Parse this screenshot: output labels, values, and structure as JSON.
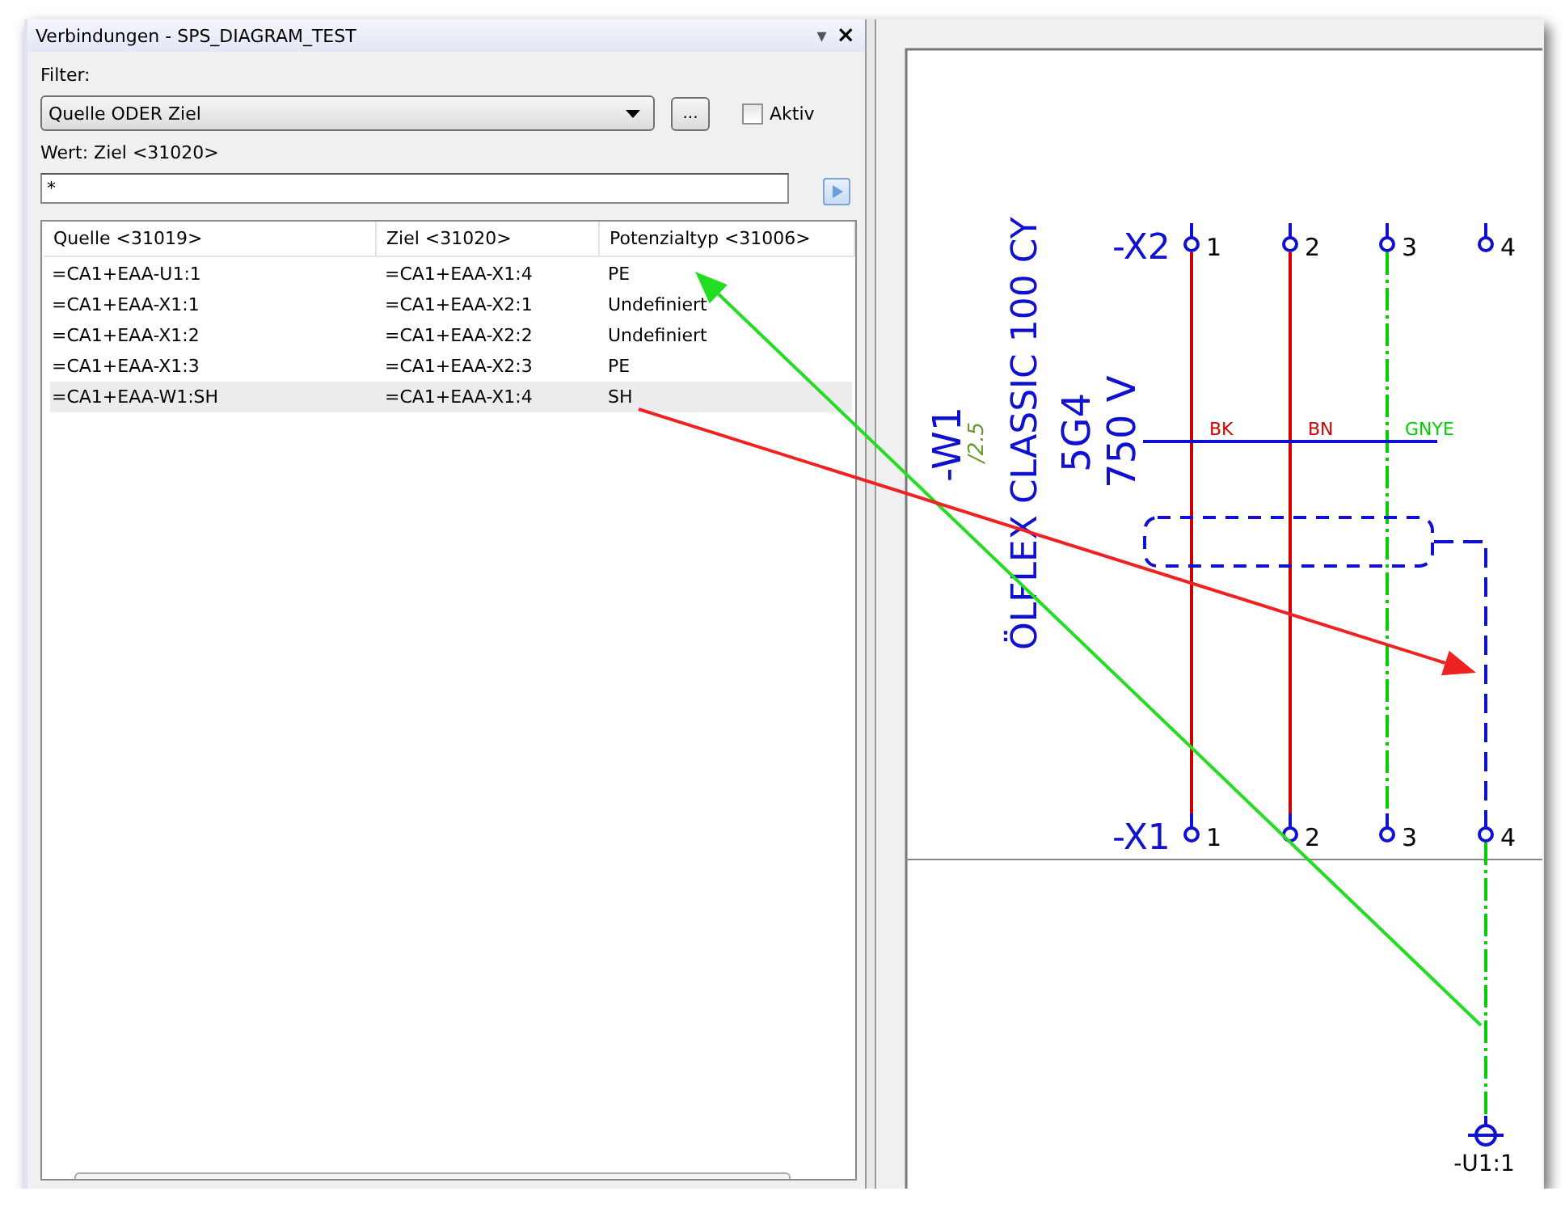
{
  "window": {
    "title": "Verbindungen - SPS_DIAGRAM_TEST",
    "menu_glyph": "▾",
    "close_glyph": "×"
  },
  "filter": {
    "label": "Filter:",
    "value": "Quelle ODER Ziel",
    "more_button": "...",
    "active": {
      "label": "Aktiv",
      "checked": false
    }
  },
  "value": {
    "label": "Wert: Ziel <31020>",
    "text": "*"
  },
  "table": {
    "columns": [
      "Quelle <31019>",
      "Ziel <31020>",
      "Potenzialtyp <31006>"
    ],
    "rows": [
      {
        "cells": [
          "=CA1+EAA-U1:1",
          "=CA1+EAA-X1:4",
          "PE"
        ],
        "selected": false
      },
      {
        "cells": [
          "=CA1+EAA-X1:1",
          "=CA1+EAA-X2:1",
          "Undefiniert"
        ],
        "selected": false
      },
      {
        "cells": [
          "=CA1+EAA-X1:2",
          "=CA1+EAA-X2:2",
          "Undefiniert"
        ],
        "selected": false
      },
      {
        "cells": [
          "=CA1+EAA-X1:3",
          "=CA1+EAA-X2:3",
          "PE"
        ],
        "selected": false
      },
      {
        "cells": [
          "=CA1+EAA-W1:SH",
          "=CA1+EAA-X1:4",
          "SH"
        ],
        "selected": true
      }
    ]
  },
  "diagram": {
    "top_strip": {
      "name": "-X2",
      "terminals": [
        "1",
        "2",
        "3",
        "4"
      ]
    },
    "bottom_strip": {
      "name": "-X1",
      "terminals": [
        "1",
        "2",
        "3",
        "4"
      ]
    },
    "cable": {
      "name": "-W1",
      "crossref": "/2.5",
      "type": "ÖLFLEX CLASSIC 100 CY",
      "cores": "5G4",
      "voltage": "750 V"
    },
    "wires": [
      {
        "label": "BK",
        "color": "#d00000",
        "kind": "solid"
      },
      {
        "label": "BN",
        "color": "#d00000",
        "kind": "solid"
      },
      {
        "label": "GNYE",
        "color": "#00d000",
        "kind": "dashdot"
      }
    ],
    "device": "-U1:1"
  },
  "annotations": [
    {
      "color": "#22dd22"
    },
    {
      "color": "#ee2222"
    }
  ]
}
